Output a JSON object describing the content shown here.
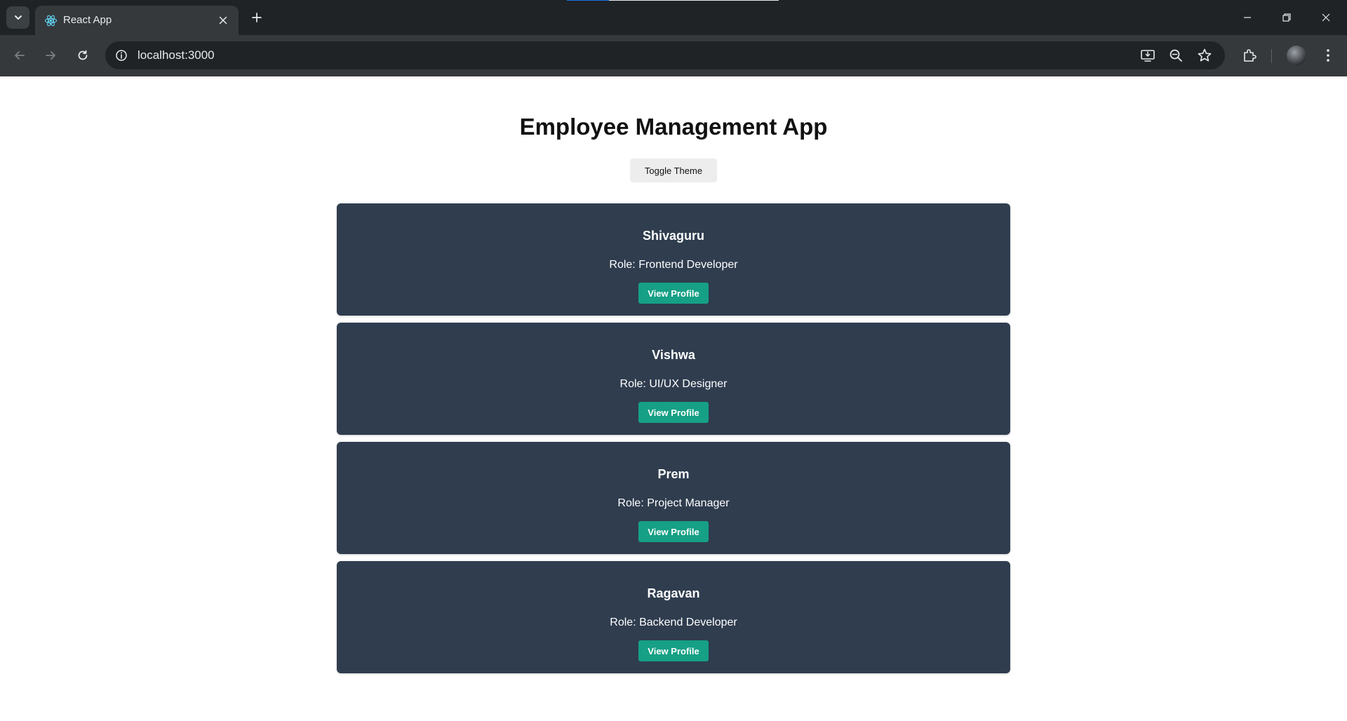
{
  "browser": {
    "tab": {
      "title": "React App",
      "favicon": "react-icon"
    },
    "url": "localhost:3000",
    "colors": {
      "tabstrip": "#1f2326",
      "toolbar": "#35393c",
      "accent": "#0b57d0"
    }
  },
  "app": {
    "title": "Employee Management App",
    "toggle_label": "Toggle Theme",
    "card_color": "#2f3d4f",
    "button_color": "#16a085",
    "employees": [
      {
        "name": "Shivaguru",
        "role": "Role: Frontend Developer",
        "button": "View Profile"
      },
      {
        "name": "Vishwa",
        "role": "Role: UI/UX Designer",
        "button": "View Profile"
      },
      {
        "name": "Prem",
        "role": "Role: Project Manager",
        "button": "View Profile"
      },
      {
        "name": "Ragavan",
        "role": "Role: Backend Developer",
        "button": "View Profile"
      }
    ]
  }
}
